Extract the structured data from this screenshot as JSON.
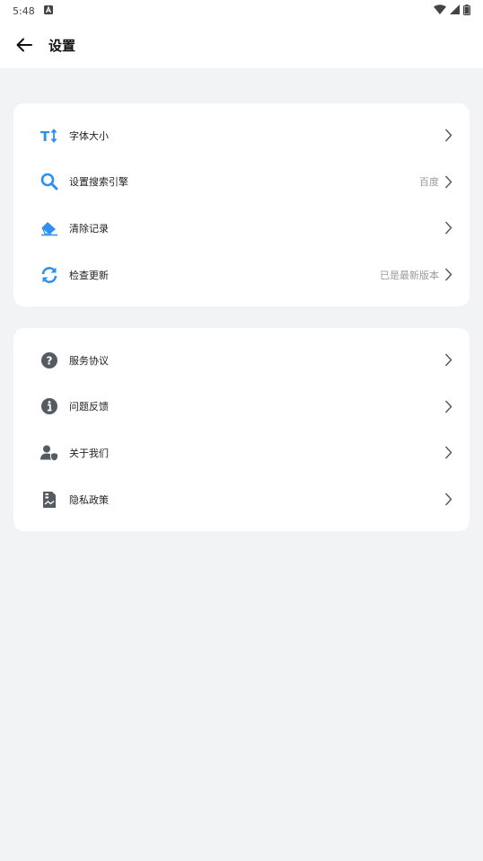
{
  "status_bar": {
    "time": "5:48"
  },
  "header": {
    "title": "设置"
  },
  "group1": [
    {
      "label": "字体大小",
      "value": "",
      "icon": "text-size-icon"
    },
    {
      "label": "设置搜索引擎",
      "value": "百度",
      "icon": "search-icon"
    },
    {
      "label": "清除记录",
      "value": "",
      "icon": "eraser-icon"
    },
    {
      "label": "检查更新",
      "value": "已是最新版本",
      "icon": "refresh-icon"
    }
  ],
  "group2": [
    {
      "label": "服务协议",
      "value": "",
      "icon": "question-circle-icon"
    },
    {
      "label": "问题反馈",
      "value": "",
      "icon": "info-circle-icon"
    },
    {
      "label": "关于我们",
      "value": "",
      "icon": "user-shield-icon"
    },
    {
      "label": "隐私政策",
      "value": "",
      "icon": "document-icon"
    }
  ],
  "colors": {
    "accent": "#2f8ff0",
    "icon_gray": "#555a63",
    "background": "#f2f3f5"
  }
}
